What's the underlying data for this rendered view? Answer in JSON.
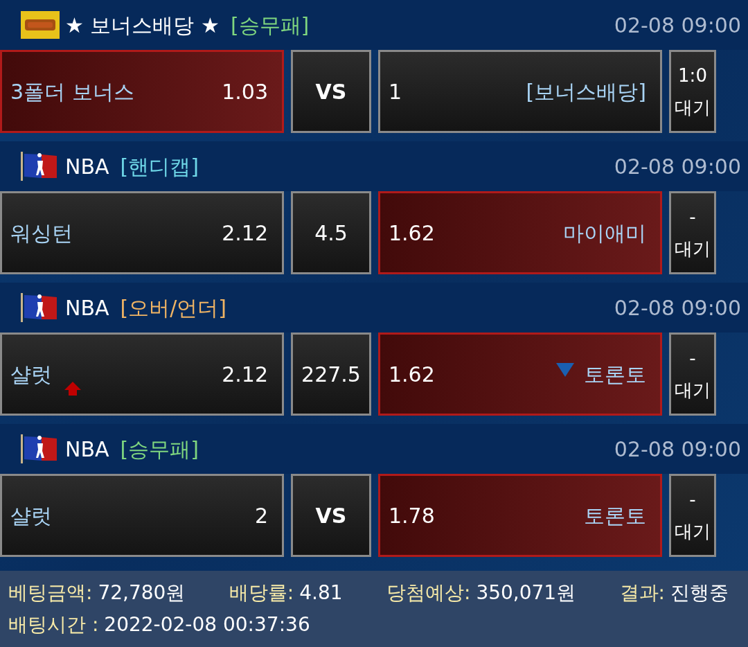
{
  "games": [
    {
      "kind": "bonus",
      "league": "★ 보너스배당 ★",
      "market": {
        "label": "[승무패]",
        "color": "#7fd67f"
      },
      "time": "02-08 09:00",
      "home": {
        "name": "3폴더 보너스",
        "odds": "1.03",
        "selected": true
      },
      "middle": {
        "text": "VS",
        "kind": "vs"
      },
      "away": {
        "odds": "1",
        "name": "[보너스배당]",
        "selected": false
      },
      "status": {
        "score": "1:0",
        "state": "대기"
      }
    },
    {
      "kind": "league",
      "league": "NBA",
      "market": {
        "label": "[핸디캡]",
        "color": "#6fd8e8"
      },
      "time": "02-08 09:00",
      "home": {
        "name": "워싱턴",
        "odds": "2.12",
        "selected": false
      },
      "middle": {
        "text": "4.5",
        "kind": "line"
      },
      "away": {
        "odds": "1.62",
        "name": "마이애미",
        "selected": true
      },
      "status": {
        "score": "-",
        "state": "대기"
      }
    },
    {
      "kind": "league",
      "league": "NBA",
      "market": {
        "label": "[오버/언더]",
        "color": "#f0b464"
      },
      "time": "02-08 09:00",
      "home": {
        "name": "샬럿",
        "odds": "2.12",
        "selected": false,
        "kind": "up"
      },
      "middle": {
        "text": "227.5",
        "kind": "line"
      },
      "away": {
        "odds": "1.62",
        "name": "토론토",
        "selected": true,
        "kind": "down"
      },
      "status": {
        "score": "-",
        "state": "대기"
      }
    },
    {
      "kind": "league",
      "league": "NBA",
      "market": {
        "label": "[승무패]",
        "color": "#7fd67f"
      },
      "time": "02-08 09:00",
      "home": {
        "name": "샬럿",
        "odds": "2",
        "selected": false
      },
      "middle": {
        "text": "VS",
        "kind": "vs"
      },
      "away": {
        "odds": "1.78",
        "name": "토론토",
        "selected": true
      },
      "status": {
        "score": "-",
        "state": "대기"
      }
    }
  ],
  "summary": [
    {
      "label": "베팅금액:",
      "value": "72,780원"
    },
    {
      "label": "배당률:",
      "value": "4.81"
    },
    {
      "label": "당첨예상:",
      "value": "350,071원"
    },
    {
      "label": "결과:",
      "value": "진행중"
    }
  ],
  "bet_time": {
    "label": "배팅시간 :",
    "value": "2022-02-08 00:37:36"
  }
}
